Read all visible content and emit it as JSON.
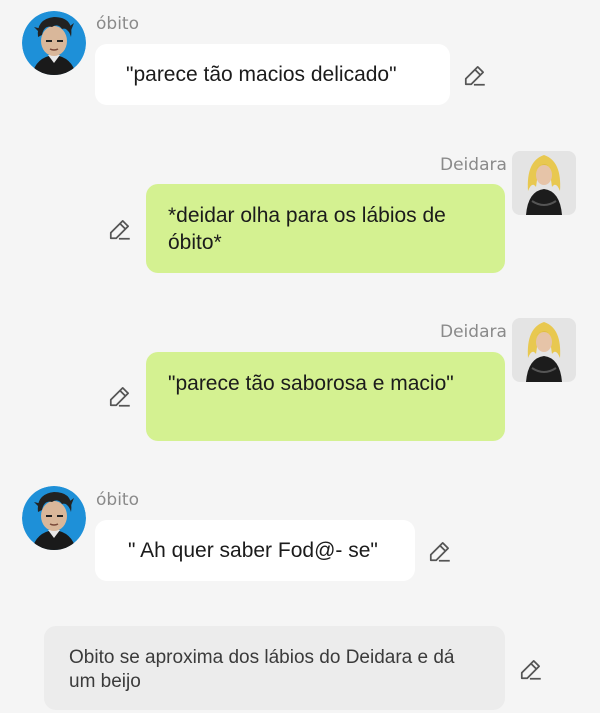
{
  "messages": [
    {
      "sender": "óbito",
      "side": "left",
      "text": "\"parece tão macios delicado\""
    },
    {
      "sender": "Deidara",
      "side": "right",
      "text": "*deidar  olha para os lábios de óbito*"
    },
    {
      "sender": "Deidara",
      "side": "right",
      "text": "\"parece tão saborosa e macio\""
    },
    {
      "sender": "óbito",
      "side": "left",
      "text": "\" Ah quer saber Fod@- se\""
    }
  ],
  "narration": {
    "text": "Obito se aproxima dos lábios do Deidara e dá um beijo"
  },
  "colors": {
    "left_bubble": "#ffffff",
    "right_bubble": "#d4f191",
    "narration_bubble": "#ececec",
    "background": "#f5f5f5"
  },
  "icons": [
    "avatar-obito",
    "avatar-deidara",
    "edit-pencil-icon"
  ]
}
